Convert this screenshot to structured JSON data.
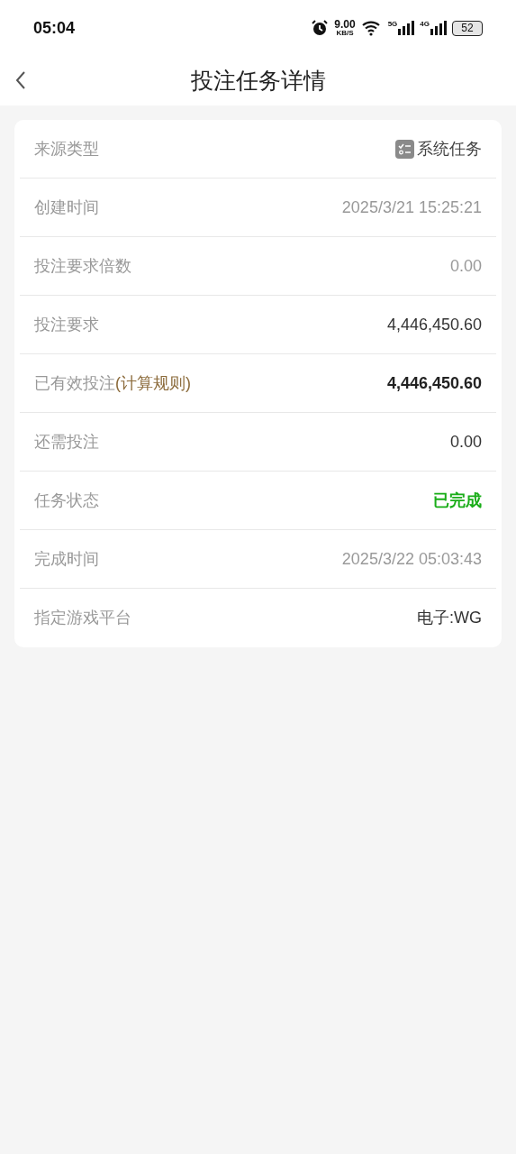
{
  "status_bar": {
    "time": "05:04",
    "net_speed": "9.00",
    "net_unit": "KB/S",
    "signal_1": "5G",
    "signal_2": "4G",
    "battery": "52"
  },
  "header": {
    "title": "投注任务详情"
  },
  "rows": [
    {
      "label": "来源类型",
      "value": "系统任务",
      "kind": "tag"
    },
    {
      "label": "创建时间",
      "value": "2025/3/21 15:25:21",
      "kind": "muted"
    },
    {
      "label": "投注要求倍数",
      "value": "0.00",
      "kind": "muted"
    },
    {
      "label": "投注要求",
      "value": "4,446,450.60",
      "kind": "normal"
    },
    {
      "label": "已有效投注",
      "link": "(计算规则)",
      "value": "4,446,450.60",
      "kind": "bold"
    },
    {
      "label": "还需投注",
      "value": "0.00",
      "kind": "normal"
    },
    {
      "label": "任务状态",
      "value": "已完成",
      "kind": "success"
    },
    {
      "label": "完成时间",
      "value": "2025/3/22 05:03:43",
      "kind": "muted"
    },
    {
      "label": "指定游戏平台",
      "value": "电子:WG",
      "kind": "normal"
    }
  ]
}
